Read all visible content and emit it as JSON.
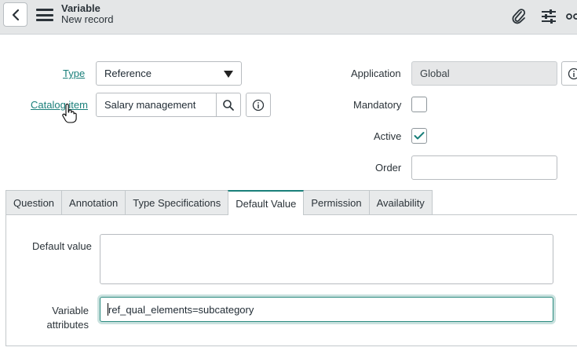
{
  "header": {
    "title": "Variable",
    "subtitle": "New record",
    "icons": [
      "chevron-left-icon",
      "menu-icon",
      "paperclip-icon",
      "sliders-icon",
      "more-icon"
    ]
  },
  "form": {
    "type": {
      "label": "Type",
      "value": "Reference"
    },
    "catalog_item": {
      "label": "Catalog item",
      "value": "Salary management"
    },
    "application": {
      "label": "Application",
      "value": "Global"
    },
    "mandatory": {
      "label": "Mandatory",
      "checked": false
    },
    "active": {
      "label": "Active",
      "checked": true
    },
    "order": {
      "label": "Order",
      "value": ""
    }
  },
  "tabs": [
    {
      "label": "Question",
      "active": false
    },
    {
      "label": "Annotation",
      "active": false
    },
    {
      "label": "Type Specifications",
      "active": false
    },
    {
      "label": "Default Value",
      "active": true
    },
    {
      "label": "Permission",
      "active": false
    },
    {
      "label": "Availability",
      "active": false
    }
  ],
  "default_value_panel": {
    "default_value_label": "Default value",
    "default_value": "",
    "variable_attributes_label_line1": "Variable",
    "variable_attributes_label_line2": "attributes",
    "variable_attributes_value": "ref_qual_elements=subcategory"
  },
  "colors": {
    "accent": "#1a7f7a",
    "header_bg": "#e4e6e7"
  }
}
